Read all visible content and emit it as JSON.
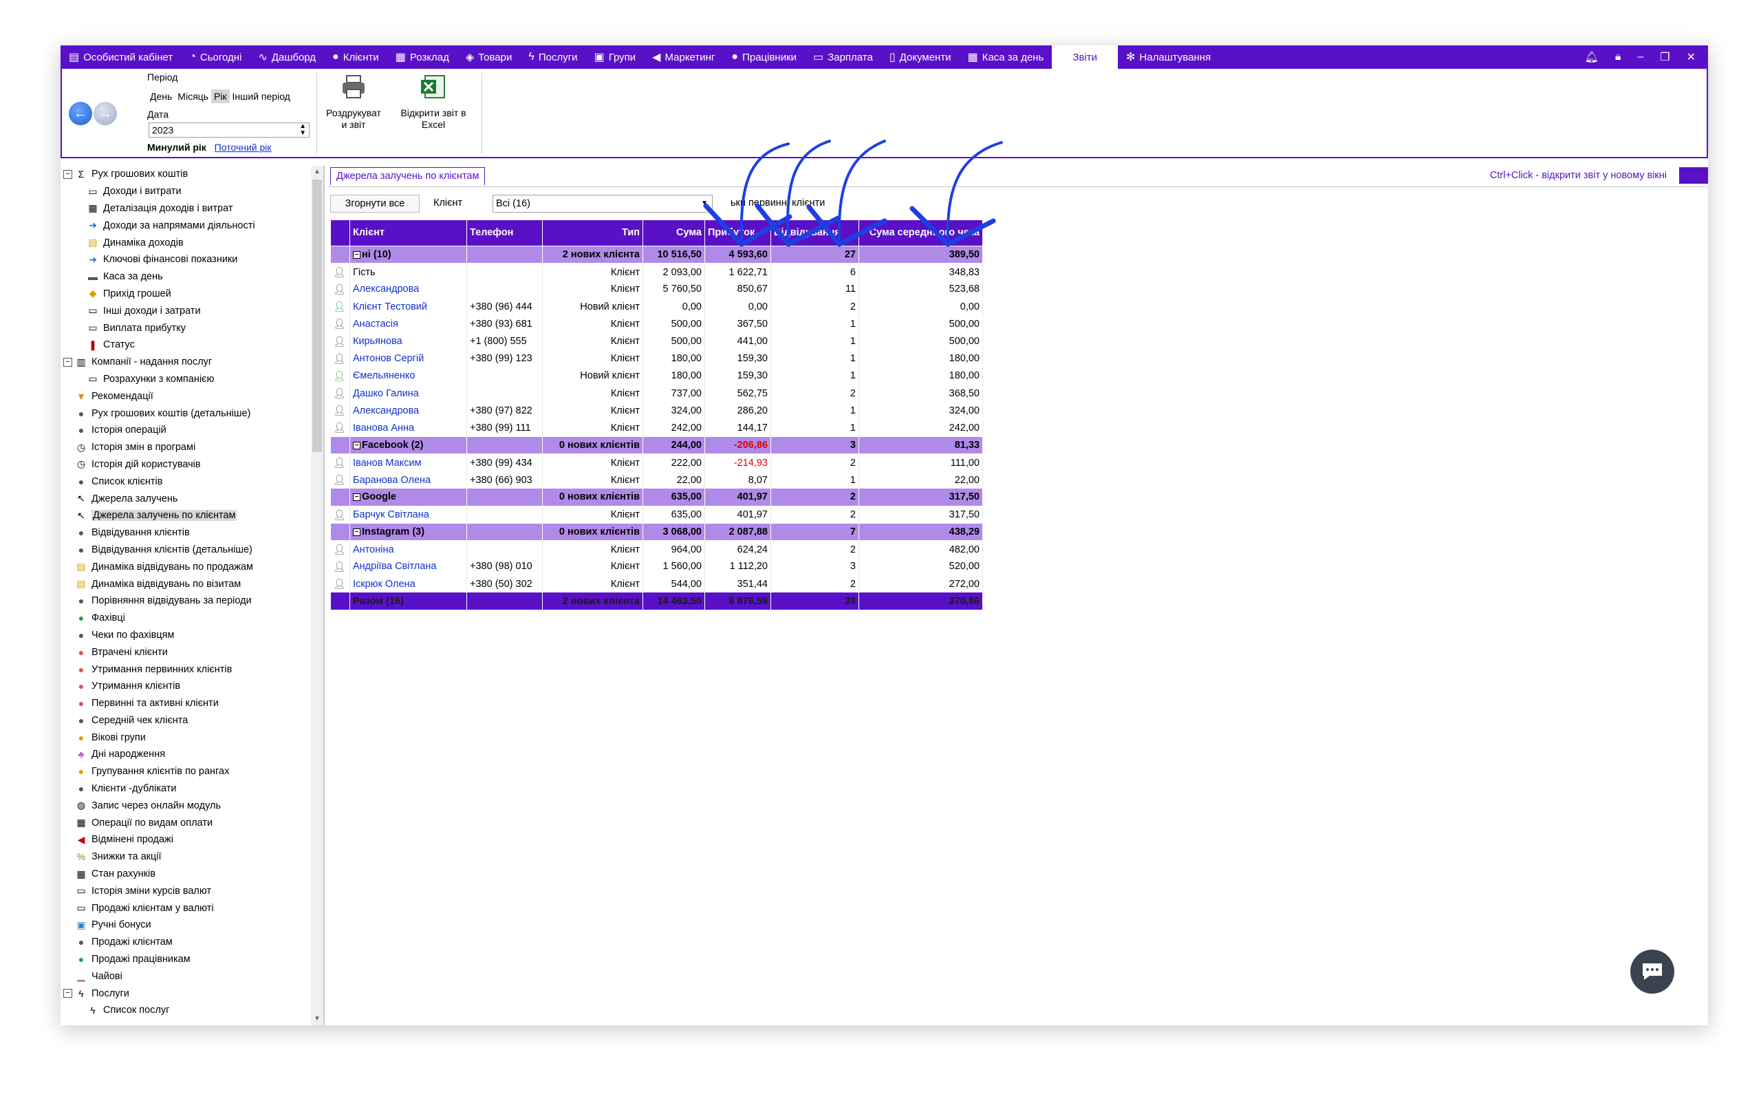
{
  "menu": [
    {
      "label": "Особистий кабінет",
      "icon": "wallet-icon",
      "glyph": "▤"
    },
    {
      "label": "Сьогодні",
      "icon": "clock-icon",
      "glyph": "◔"
    },
    {
      "label": "Дашборд",
      "icon": "pulse-icon",
      "glyph": "∿"
    },
    {
      "label": "Клієнти",
      "icon": "user-circle-icon",
      "glyph": "●"
    },
    {
      "label": "Розклад",
      "icon": "calendar-icon",
      "glyph": "▦"
    },
    {
      "label": "Товари",
      "icon": "box-icon",
      "glyph": "◈"
    },
    {
      "label": "Послуги",
      "icon": "lightning-icon",
      "glyph": "ϟ"
    },
    {
      "label": "Групи",
      "icon": "group-icon",
      "glyph": "▣"
    },
    {
      "label": "Маркетинг",
      "icon": "megaphone-icon",
      "glyph": "◀"
    },
    {
      "label": "Працівники",
      "icon": "person-icon",
      "glyph": "●"
    },
    {
      "label": "Зарплата",
      "icon": "money-icon",
      "glyph": "▭"
    },
    {
      "label": "Документи",
      "icon": "document-icon",
      "glyph": "▯"
    },
    {
      "label": "Каса за день",
      "icon": "calculator-icon",
      "glyph": "▦"
    },
    {
      "label": "Звіти",
      "icon": "",
      "glyph": "",
      "active": true
    },
    {
      "label": "Налаштування",
      "icon": "gear-icon",
      "glyph": "✻"
    }
  ],
  "toolbar": {
    "period_label": "Період",
    "period_options": [
      "День",
      "Місяць",
      "Рік",
      "Інший період"
    ],
    "selected_period": "Рік",
    "date_label": "Дата",
    "date_value": "2023",
    "last_year": "Минулий рік",
    "current_year": "Поточний рік",
    "print_line1": "Роздрукуват",
    "print_line2": "и звіт",
    "excel_line1": "Відкрити звіт в",
    "excel_line2": "Excel"
  },
  "tree": [
    {
      "label": "Рух грошових коштів",
      "level": 0,
      "exp": "□",
      "icon": "sigma-icon",
      "glyph": "Σ"
    },
    {
      "label": "Доходи і витрати",
      "level": 1,
      "icon": "money-icon",
      "glyph": "▭"
    },
    {
      "label": "Деталізація доходів і витрат",
      "level": 1,
      "icon": "calculator-icon",
      "glyph": "▦"
    },
    {
      "label": "Доходи за напрямами діяльності",
      "level": 1,
      "icon": "arrow-icon",
      "glyph": "➜",
      "color": "#2a6ad8"
    },
    {
      "label": "Динаміка доходів",
      "level": 1,
      "icon": "chart-icon",
      "glyph": "▤",
      "color": "#d9a000"
    },
    {
      "label": "Ключові фінансові показники",
      "level": 1,
      "icon": "arrow-icon",
      "glyph": "➜",
      "color": "#2a6ad8"
    },
    {
      "label": "Каса за день",
      "level": 1,
      "icon": "cashbox-icon",
      "glyph": "▬",
      "color": "#555"
    },
    {
      "label": "Прихід грошей",
      "level": 1,
      "icon": "coins-icon",
      "glyph": "◆",
      "color": "#d9a000"
    },
    {
      "label": "Інші доходи і затрати",
      "level": 1,
      "icon": "money-icon",
      "glyph": "▭"
    },
    {
      "label": "Виплата прибутку",
      "level": 1,
      "icon": "money-icon",
      "glyph": "▭"
    },
    {
      "label": "Статус",
      "level": 1,
      "icon": "status-icon",
      "glyph": "❚",
      "color": "#b00000"
    },
    {
      "label": "Компанії - надання послуг",
      "level": 0,
      "exp": "□",
      "icon": "building-icon",
      "glyph": "▥"
    },
    {
      "label": "Розрахунки з компанією",
      "level": 1,
      "icon": "money-icon",
      "glyph": "▭"
    },
    {
      "label": "Рекомендації",
      "level": 0,
      "icon": "trophy-icon",
      "glyph": "▼",
      "color": "#e08a00"
    },
    {
      "label": "Рух грошових коштів (детальніше)",
      "level": 0,
      "icon": "clock-icon",
      "glyph": "●",
      "color": "#555"
    },
    {
      "label": "Історія операцій",
      "level": 0,
      "icon": "clock-icon",
      "glyph": "●",
      "color": "#555"
    },
    {
      "label": "Історія змін в програмі",
      "level": 0,
      "icon": "history-icon",
      "glyph": "◷"
    },
    {
      "label": "Історія дій користувачів",
      "level": 0,
      "icon": "history-icon",
      "glyph": "◷"
    },
    {
      "label": "Список клієнтів",
      "level": 0,
      "icon": "person-icon",
      "glyph": "●",
      "color": "#555"
    },
    {
      "label": "Джерела залучень",
      "level": 0,
      "icon": "cursor-icon",
      "glyph": "↖"
    },
    {
      "label": "Джерела залучень по клієнтам",
      "level": 0,
      "icon": "cursor-icon",
      "glyph": "↖",
      "selected": true
    },
    {
      "label": "Відвідування клієнтів",
      "level": 0,
      "icon": "person-icon",
      "glyph": "●",
      "color": "#555"
    },
    {
      "label": "Відвідування клієнтів (детальніше)",
      "level": 0,
      "icon": "person-icon",
      "glyph": "●",
      "color": "#555"
    },
    {
      "label": "Динаміка відвідувань по продажам",
      "level": 0,
      "icon": "chart-icon",
      "glyph": "▤",
      "color": "#d9a000"
    },
    {
      "label": "Динаміка відвідувань по візитам",
      "level": 0,
      "icon": "chart-icon",
      "glyph": "▤",
      "color": "#d9a000"
    },
    {
      "label": "Порівняння відвідувань за періоди",
      "level": 0,
      "icon": "person-icon",
      "glyph": "●",
      "color": "#555"
    },
    {
      "label": "Фахівці",
      "level": 0,
      "icon": "person-icon",
      "glyph": "●",
      "color": "#22a040"
    },
    {
      "label": "Чеки по фахівцям",
      "level": 0,
      "icon": "person-icon",
      "glyph": "●",
      "color": "#555"
    },
    {
      "label": "Втрачені клієнти",
      "level": 0,
      "icon": "person-icon",
      "glyph": "●",
      "color": "#e05050"
    },
    {
      "label": "Утримання первинних клієнтів",
      "level": 0,
      "icon": "person-icon",
      "glyph": "●",
      "color": "#e05050"
    },
    {
      "label": "Утримання клієнтів",
      "level": 0,
      "icon": "person-icon",
      "glyph": "●",
      "color": "#e05050"
    },
    {
      "label": "Первинні та активні клієнти",
      "level": 0,
      "icon": "person-icon",
      "glyph": "●",
      "color": "#e05050"
    },
    {
      "label": "Середній чек клієнта",
      "level": 0,
      "icon": "person-icon",
      "glyph": "●",
      "color": "#555"
    },
    {
      "label": "Вікові групи",
      "level": 0,
      "icon": "person-icon",
      "glyph": "●",
      "color": "#e0a000"
    },
    {
      "label": "Дні народження",
      "level": 0,
      "icon": "cake-icon",
      "glyph": "♣",
      "color": "#c060c0"
    },
    {
      "label": "Групування клієнтів по рангах",
      "level": 0,
      "icon": "person-icon",
      "glyph": "●",
      "color": "#e0a000"
    },
    {
      "label": "Клієнти -дублікати",
      "level": 0,
      "icon": "people-icon",
      "glyph": "●",
      "color": "#555"
    },
    {
      "label": "Запис через онлайн модуль",
      "level": 0,
      "icon": "globe-icon",
      "glyph": "◍"
    },
    {
      "label": "Операції по видам оплати",
      "level": 0,
      "icon": "calculator-icon",
      "glyph": "▦"
    },
    {
      "label": "Відмінені продажі",
      "level": 0,
      "icon": "cancel-sale-icon",
      "glyph": "◀",
      "color": "#c00000"
    },
    {
      "label": "Знижки та акції",
      "level": 0,
      "icon": "percent-icon",
      "glyph": "%",
      "color": "#60a020"
    },
    {
      "label": "Стан рахунків",
      "level": 0,
      "icon": "calculator-icon",
      "glyph": "▦"
    },
    {
      "label": "Історія зміни курсів валют",
      "level": 0,
      "icon": "money-icon",
      "glyph": "▭"
    },
    {
      "label": "Продажі клієнтам у валюті",
      "level": 0,
      "icon": "money-icon",
      "glyph": "▭"
    },
    {
      "label": "Ручні бонуси",
      "level": 0,
      "icon": "bonus-icon",
      "glyph": "▣",
      "color": "#3080c0"
    },
    {
      "label": "Продажі клієнтам",
      "level": 0,
      "icon": "person-icon",
      "glyph": "●",
      "color": "#555"
    },
    {
      "label": "Продажі працівникам",
      "level": 0,
      "icon": "person-icon",
      "glyph": "●",
      "color": "#22a040"
    },
    {
      "label": "Чайові",
      "level": 0,
      "icon": "tips-icon",
      "glyph": "▁",
      "color": "#a06040"
    },
    {
      "label": "Послуги",
      "level": 0,
      "exp": "□",
      "icon": "lightning-icon",
      "glyph": "ϟ"
    },
    {
      "label": "Список послуг",
      "level": 1,
      "icon": "lightning-icon",
      "glyph": "ϟ"
    }
  ],
  "report": {
    "tab_label": "Джерела залучень по клієнтам",
    "ctrl_hint": "Ctrl+Click - відкрити звіт у новому вікні",
    "collapse_label": "Згорнути все",
    "client_label": "Клієнт",
    "client_value": "Всі (16)",
    "first_only_label": "ьки первинні клієнти",
    "columns": [
      "Клієнт",
      "Телефон",
      "Тип",
      "Сума",
      "Прибуток",
      "Відвідування",
      "Сума середнього чека"
    ],
    "rows": [
      {
        "kind": "group",
        "client": "ні (10)",
        "phone": "",
        "type": "2 нових клієнта",
        "sum": "10 516,50",
        "profit": "4 593,60",
        "visits": "27",
        "avg": "389,50"
      },
      {
        "kind": "item",
        "icon": "grey",
        "client": "Гість",
        "plain": true,
        "phone": "",
        "type": "Клієнт",
        "sum": "2 093,00",
        "profit": "1 622,71",
        "visits": "6",
        "avg": "348,83"
      },
      {
        "kind": "item",
        "icon": "grey",
        "client": "Александрова",
        "phone": "",
        "type": "Клієнт",
        "sum": "5 760,50",
        "profit": "850,67",
        "visits": "11",
        "avg": "523,68"
      },
      {
        "kind": "item",
        "icon": "green",
        "client": "Клієнт Тестовий",
        "phone": "+380 (96) 444",
        "type": "Новий клієнт",
        "sum": "0,00",
        "profit": "0,00",
        "visits": "2",
        "avg": "0,00"
      },
      {
        "kind": "item",
        "icon": "grey",
        "client": "Анастасія",
        "phone": "+380 (93) 681",
        "type": "Клієнт",
        "sum": "500,00",
        "profit": "367,50",
        "visits": "1",
        "avg": "500,00"
      },
      {
        "kind": "item",
        "icon": "grey",
        "client": "Кирьянова",
        "phone": "+1 (800) 555",
        "type": "Клієнт",
        "sum": "500,00",
        "profit": "441,00",
        "visits": "1",
        "avg": "500,00"
      },
      {
        "kind": "item",
        "icon": "grey",
        "client": "Антонов Сергій",
        "phone": "+380 (99) 123",
        "type": "Клієнт",
        "sum": "180,00",
        "profit": "159,30",
        "visits": "1",
        "avg": "180,00"
      },
      {
        "kind": "item",
        "icon": "green",
        "client": "Ємельяненко",
        "phone": "",
        "type": "Новий клієнт",
        "sum": "180,00",
        "profit": "159,30",
        "visits": "1",
        "avg": "180,00"
      },
      {
        "kind": "item",
        "icon": "grey",
        "client": "Дашко Галина",
        "phone": "",
        "type": "Клієнт",
        "sum": "737,00",
        "profit": "562,75",
        "visits": "2",
        "avg": "368,50"
      },
      {
        "kind": "item",
        "icon": "grey",
        "client": "Александрова",
        "phone": "+380 (97) 822",
        "type": "Клієнт",
        "sum": "324,00",
        "profit": "286,20",
        "visits": "1",
        "avg": "324,00"
      },
      {
        "kind": "item",
        "icon": "grey",
        "client": "Іванова Анна",
        "phone": "+380 (99) 111",
        "type": "Клієнт",
        "sum": "242,00",
        "profit": "144,17",
        "visits": "1",
        "avg": "242,00"
      },
      {
        "kind": "group",
        "client": "Facebook (2)",
        "phone": "",
        "type": "0 нових клієнтів",
        "sum": "244,00",
        "profit": "-206,86",
        "neg": true,
        "visits": "3",
        "avg": "81,33"
      },
      {
        "kind": "item",
        "icon": "grey",
        "client": "Іванов Максим",
        "phone": "+380 (99) 434",
        "type": "Клієнт",
        "sum": "222,00",
        "profit": "-214,93",
        "neg": true,
        "visits": "2",
        "avg": "111,00"
      },
      {
        "kind": "item",
        "icon": "grey",
        "client": "Баранова Олена",
        "phone": "+380 (66) 903",
        "type": "Клієнт",
        "sum": "22,00",
        "profit": "8,07",
        "visits": "1",
        "avg": "22,00"
      },
      {
        "kind": "group",
        "client": "Google",
        "phone": "",
        "type": "0 нових клієнтів",
        "sum": "635,00",
        "profit": "401,97",
        "visits": "2",
        "avg": "317,50"
      },
      {
        "kind": "item",
        "icon": "grey",
        "client": "Барчук Світлана",
        "phone": "",
        "type": "Клієнт",
        "sum": "635,00",
        "profit": "401,97",
        "visits": "2",
        "avg": "317,50"
      },
      {
        "kind": "group",
        "client": "Instagram (3)",
        "phone": "",
        "type": "0 нових клієнтів",
        "sum": "3 068,00",
        "profit": "2 087,88",
        "visits": "7",
        "avg": "438,29"
      },
      {
        "kind": "item",
        "icon": "grey",
        "client": "Антоніна",
        "phone": "",
        "type": "Клієнт",
        "sum": "964,00",
        "profit": "624,24",
        "visits": "2",
        "avg": "482,00"
      },
      {
        "kind": "item",
        "icon": "grey",
        "client": "Андріїва Світлана",
        "phone": "+380 (98) 010",
        "type": "Клієнт",
        "sum": "1 560,00",
        "profit": "1 112,20",
        "visits": "3",
        "avg": "520,00"
      },
      {
        "kind": "item",
        "icon": "grey",
        "client": "Іскрюк Олена",
        "phone": "+380 (50) 302",
        "type": "Клієнт",
        "sum": "544,00",
        "profit": "351,44",
        "visits": "2",
        "avg": "272,00"
      },
      {
        "kind": "total",
        "client": "Разом (16)",
        "phone": "",
        "type": "2 нових клієнта",
        "sum": "14 463,50",
        "profit": "6 876,59",
        "visits": "39",
        "avg": "370,86"
      }
    ]
  },
  "colors": {
    "accent": "#5a10c7",
    "group_row": "#b08ae8",
    "link": "#1030d0",
    "negative": "#e00000",
    "annotation_arrow": "#1f3fe0"
  }
}
